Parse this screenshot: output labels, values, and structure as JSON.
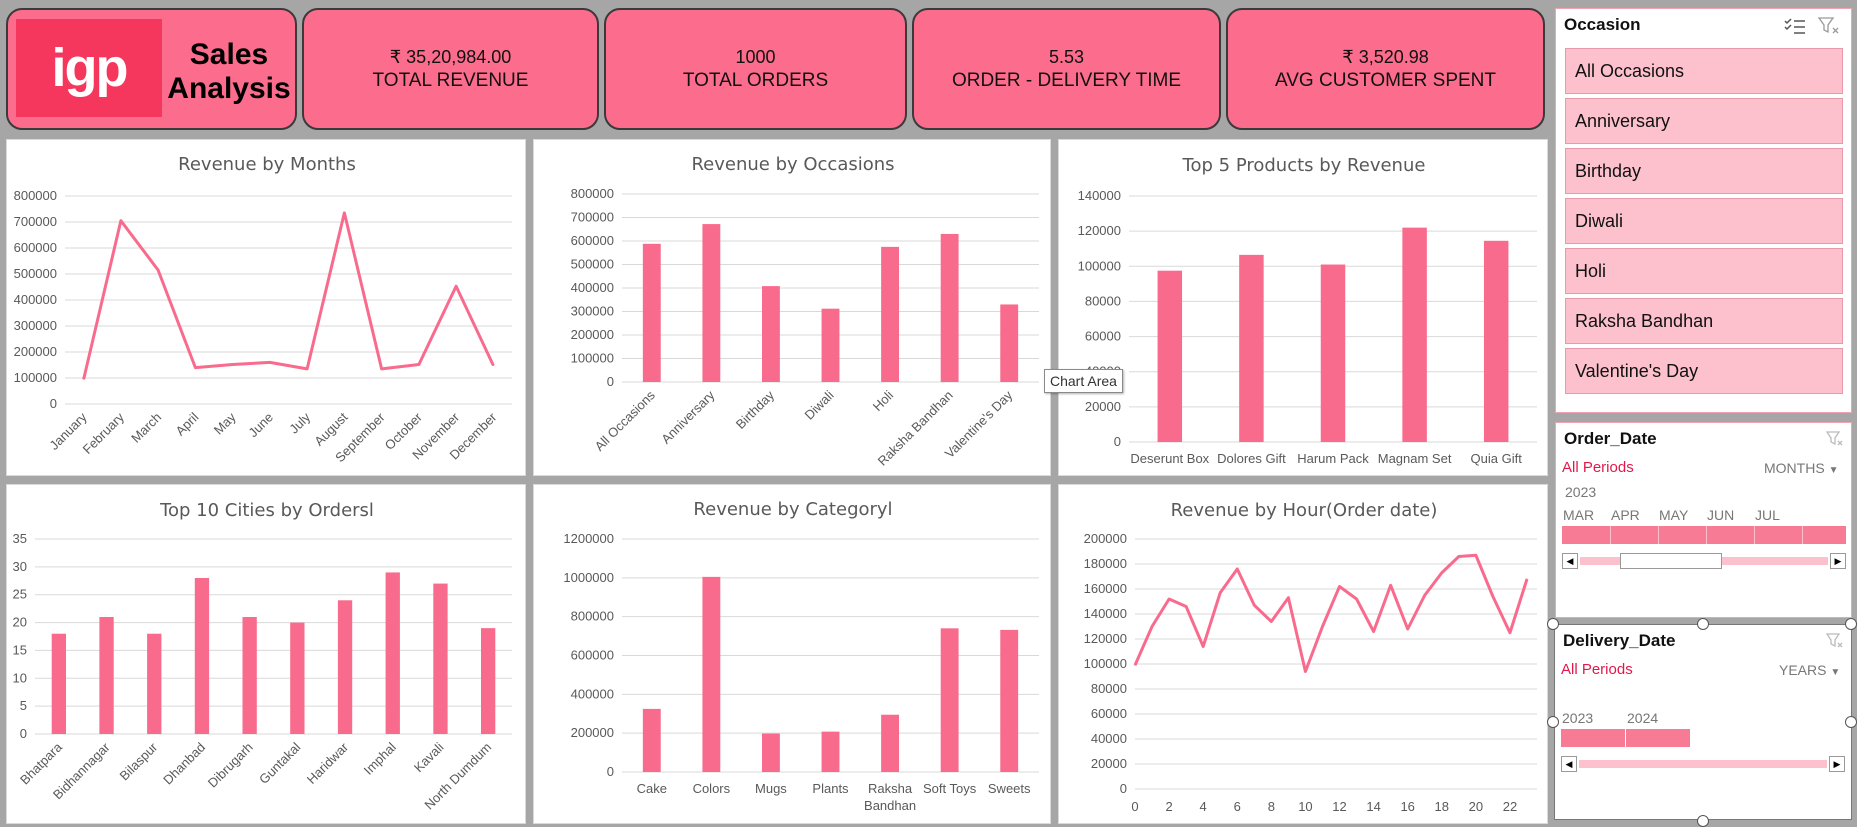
{
  "header": {
    "logo_text": "igp",
    "title_line1": "Sales",
    "title_line2": "Analysis",
    "kpis": [
      {
        "value": "₹ 35,20,984.00",
        "label": "TOTAL REVENUE"
      },
      {
        "value": "1000",
        "label": "TOTAL ORDERS"
      },
      {
        "value": "5.53",
        "label": "ORDER - DELIVERY TIME"
      },
      {
        "value": "₹ 3,520.98",
        "label": "AVG CUSTOMER SPENT"
      }
    ]
  },
  "colors": {
    "accent": "#fc6c8c",
    "bar": "#f96b8d",
    "logo": "#f6375d",
    "slicer_item": "#fcc1cd",
    "slicer_highlight": "#e3184a"
  },
  "tooltip": "Chart Area",
  "chart_data": [
    {
      "type": "line",
      "title": "Revenue by Months",
      "categories": [
        "January",
        "February",
        "March",
        "April",
        "May",
        "June",
        "July",
        "August",
        "September",
        "October",
        "November",
        "December"
      ],
      "values": [
        95000,
        705000,
        515000,
        140000,
        152000,
        160000,
        135000,
        735000,
        135000,
        152000,
        453000,
        148000
      ],
      "ylim": [
        0,
        800000
      ],
      "yticks": [
        "0",
        "100000",
        "200000",
        "300000",
        "400000",
        "500000",
        "600000",
        "700000",
        "800000"
      ],
      "grid": true
    },
    {
      "type": "bar",
      "title": "Revenue by Occasions",
      "categories": [
        "All Occasions",
        "Anniversary",
        "Birthday",
        "Diwali",
        "Holi",
        "Raksha Bandhan",
        "Valentine's Day"
      ],
      "values": [
        588000,
        672000,
        408000,
        312000,
        575000,
        630000,
        330000
      ],
      "ylim": [
        0,
        800000
      ],
      "yticks": [
        "0",
        "100000",
        "200000",
        "300000",
        "400000",
        "500000",
        "600000",
        "700000",
        "800000"
      ],
      "grid": true
    },
    {
      "type": "bar",
      "title": "Top 5 Products by Revenue",
      "categories": [
        "Deserunt Box",
        "Dolores Gift",
        "Harum Pack",
        "Magnam Set",
        "Quia Gift"
      ],
      "values": [
        97500,
        106500,
        101000,
        122000,
        114500
      ],
      "ylim": [
        0,
        140000
      ],
      "yticks": [
        "0",
        "20000",
        "40000",
        "60000",
        "80000",
        "100000",
        "120000",
        "140000"
      ],
      "grid": true
    },
    {
      "type": "bar",
      "title": "Top 10 Cities by Ordersl",
      "categories": [
        "Bhatpara",
        "Bidhannagar",
        "Bilaspur",
        "Dhanbad",
        "Dibrugarh",
        "Guntakal",
        "Haridwar",
        "Imphal",
        "Kavali",
        "North Dumdum"
      ],
      "values": [
        18,
        21,
        18,
        28,
        21,
        20,
        24,
        29,
        27,
        19
      ],
      "ylim": [
        0,
        35
      ],
      "yticks": [
        "0",
        "5",
        "10",
        "15",
        "20",
        "25",
        "30",
        "35"
      ],
      "grid": true
    },
    {
      "type": "bar",
      "title": "Revenue by Categoryl",
      "categories": [
        "Cake",
        "Colors",
        "Mugs",
        "Plants",
        "Raksha Bandhan",
        "Soft Toys",
        "Sweets"
      ],
      "values": [
        325000,
        1005000,
        198000,
        208000,
        295000,
        740000,
        732000
      ],
      "ylim": [
        0,
        1200000
      ],
      "yticks": [
        "0",
        "200000",
        "400000",
        "600000",
        "800000",
        "1000000",
        "1200000"
      ],
      "grid": true
    },
    {
      "type": "line",
      "title": "Revenue by Hour(Order date)",
      "x": [
        0,
        1,
        2,
        3,
        4,
        5,
        6,
        7,
        8,
        9,
        10,
        11,
        12,
        13,
        14,
        15,
        16,
        17,
        18,
        19,
        20,
        21,
        22,
        23
      ],
      "values": [
        99000,
        130000,
        152000,
        146000,
        114000,
        157000,
        176000,
        147000,
        134000,
        153000,
        94000,
        130000,
        162000,
        152000,
        126000,
        163000,
        128000,
        155000,
        173000,
        186000,
        187000,
        154000,
        125000,
        168000
      ],
      "xticks": [
        "0",
        "2",
        "4",
        "6",
        "8",
        "10",
        "12",
        "14",
        "16",
        "18",
        "20",
        "22"
      ],
      "ylim": [
        0,
        200000
      ],
      "yticks": [
        "0",
        "20000",
        "40000",
        "60000",
        "80000",
        "100000",
        "120000",
        "140000",
        "160000",
        "180000",
        "200000"
      ],
      "grid": true
    }
  ],
  "slicers": {
    "occasion": {
      "title": "Occasion",
      "items": [
        "All Occasions",
        "Anniversary",
        "Birthday",
        "Diwali",
        "Holi",
        "Raksha Bandhan",
        "Valentine's Day"
      ]
    },
    "order_date": {
      "title": "Order_Date",
      "period_label": "All Periods",
      "level": "MONTHS",
      "year": "2023",
      "months": [
        "MAR",
        "APR",
        "MAY",
        "JUN",
        "JUL"
      ]
    },
    "delivery_date": {
      "title": "Delivery_Date",
      "period_label": "All Periods",
      "level": "YEARS",
      "years": [
        "2023",
        "2024"
      ]
    }
  }
}
